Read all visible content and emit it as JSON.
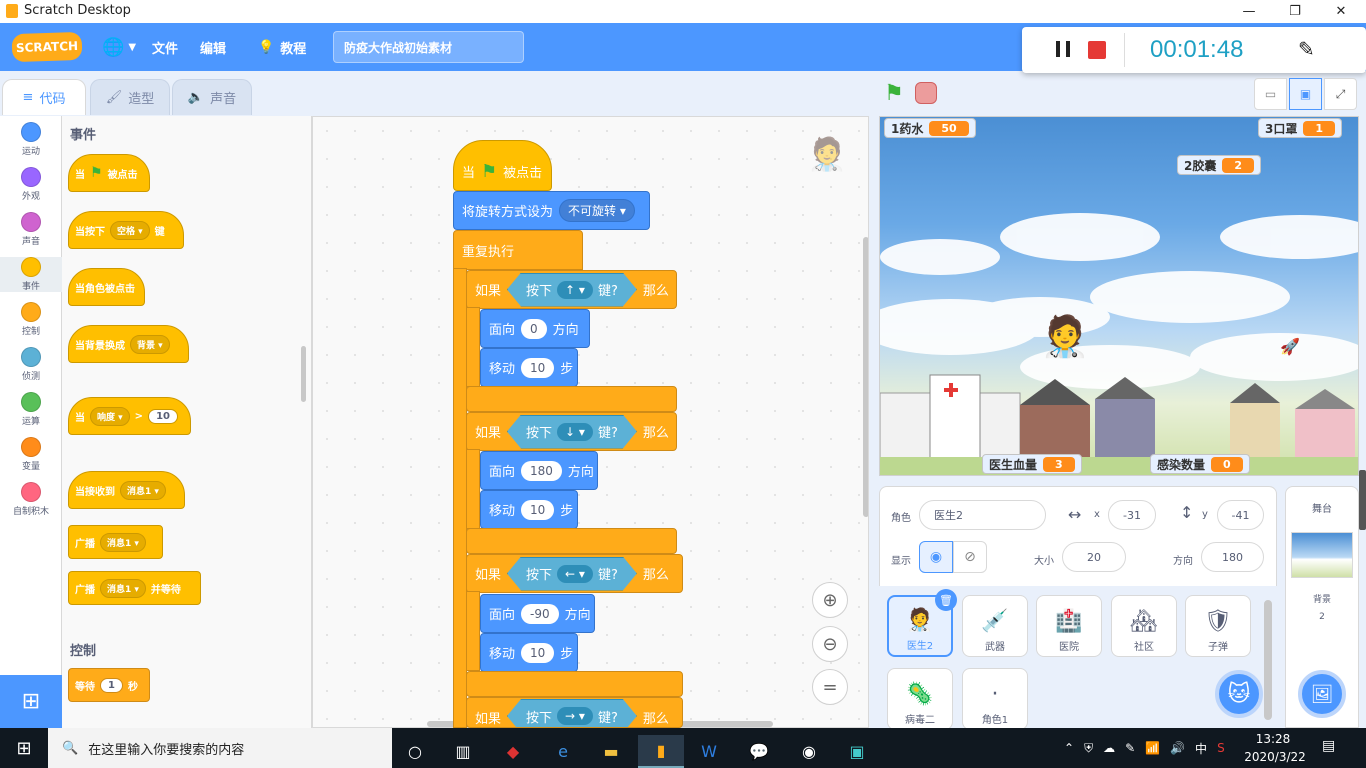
{
  "window": {
    "title": "Scratch Desktop",
    "controls": [
      "minimize",
      "maximize",
      "close"
    ]
  },
  "menubar": {
    "logo": "SCRATCH",
    "globe": "globe-icon",
    "file": "文件",
    "edit": "编辑",
    "tutorials": "教程",
    "project_title": "防疫大作战初始素材"
  },
  "recorder": {
    "time": "00:01:48"
  },
  "tabs": [
    "代码",
    "造型",
    "声音"
  ],
  "categories": [
    {
      "label": "运动",
      "color": "#4c97ff"
    },
    {
      "label": "外观",
      "color": "#9966ff"
    },
    {
      "label": "声音",
      "color": "#cf63cf"
    },
    {
      "label": "事件",
      "color": "#ffbf00"
    },
    {
      "label": "控制",
      "color": "#ffab19"
    },
    {
      "label": "侦测",
      "color": "#5cb1d6"
    },
    {
      "label": "运算",
      "color": "#59c059"
    },
    {
      "label": "变量",
      "color": "#ff8c1a"
    },
    {
      "label": "自制积木",
      "color": "#ff6680"
    }
  ],
  "palette": {
    "events_heading": "事件",
    "control_heading": "控制",
    "b1": {
      "a": "当",
      "b": "被点击"
    },
    "b2": {
      "a": "当按下",
      "dd": "空格",
      "b": "键"
    },
    "b3": {
      "a": "当角色被点击"
    },
    "b4": {
      "a": "当背景换成",
      "dd": "背景"
    },
    "b5": {
      "a": "当",
      "dd": "响度",
      "op": ">",
      "val": "10"
    },
    "b6": {
      "a": "当接收到",
      "dd": "消息1"
    },
    "b7": {
      "a": "广播",
      "dd": "消息1"
    },
    "b8": {
      "a": "广播",
      "dd": "消息1",
      "b": "并等待"
    },
    "b9": {
      "a": "等待",
      "val": "1",
      "b": "秒"
    }
  },
  "script": {
    "hat": {
      "a": "当",
      "b": "被点击"
    },
    "rot": {
      "a": "将旋转方式设为",
      "dd": "不可旋转"
    },
    "forever": "重复执行",
    "ifs": [
      {
        "if": "如果",
        "press": "按下",
        "key": "↑",
        "q": "键?",
        "then": "那么",
        "face": "面向",
        "deg": "0",
        "dir": "方向",
        "move": "移动",
        "steps": "10",
        "step": "步"
      },
      {
        "if": "如果",
        "press": "按下",
        "key": "↓",
        "q": "键?",
        "then": "那么",
        "face": "面向",
        "deg": "180",
        "dir": "方向",
        "move": "移动",
        "steps": "10",
        "step": "步"
      },
      {
        "if": "如果",
        "press": "按下",
        "key": "←",
        "q": "键?",
        "then": "那么",
        "face": "面向",
        "deg": "-90",
        "dir": "方向",
        "move": "移动",
        "steps": "10",
        "step": "步"
      },
      {
        "if": "如果",
        "press": "按下",
        "key": "→",
        "q": "键?",
        "then": "那么"
      }
    ]
  },
  "monitors": [
    {
      "label": "1药水",
      "value": "50"
    },
    {
      "label": "3口罩",
      "value": "1"
    },
    {
      "label": "2胶囊",
      "value": "2"
    },
    {
      "label": "医生血量",
      "value": "3"
    },
    {
      "label": "感染数量",
      "value": "0"
    }
  ],
  "sprite_info": {
    "sprite_label": "角色",
    "sprite_name": "医生2",
    "x_label": "x",
    "x": "-31",
    "y_label": "y",
    "y": "-41",
    "show_label": "显示",
    "size_label": "大小",
    "size": "20",
    "dir_label": "方向",
    "dir": "180"
  },
  "sprites": [
    "医生2",
    "武器",
    "医院",
    "社区",
    "子弹",
    "病毒二",
    "角色1"
  ],
  "stage_panel": {
    "title": "舞台",
    "backdrop_label": "背景",
    "backdrop_count": "2"
  },
  "taskbar": {
    "search_placeholder": "在这里输入你要搜索的内容",
    "time": "13:28",
    "date": "2020/3/22",
    "ime": "中"
  }
}
